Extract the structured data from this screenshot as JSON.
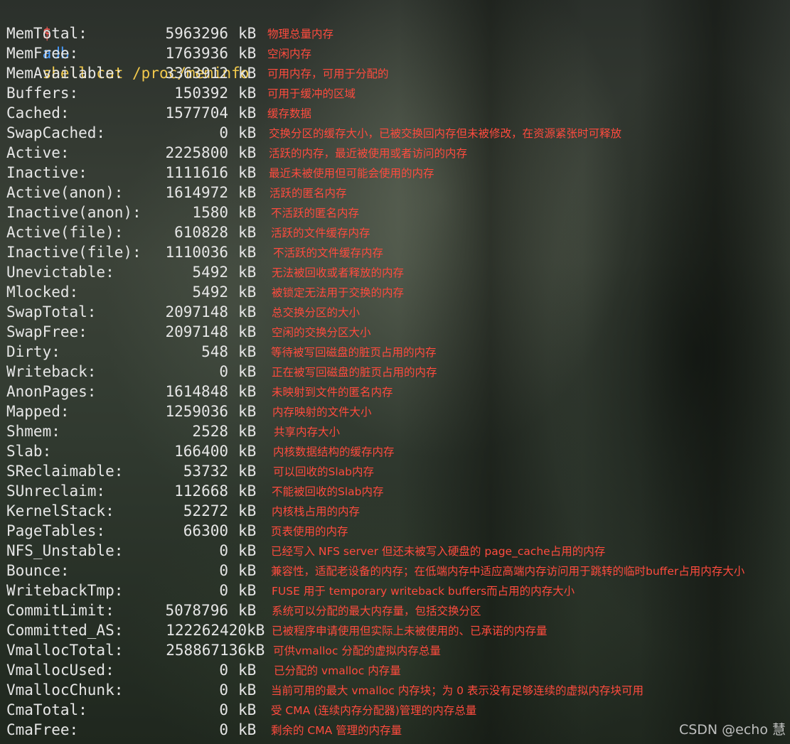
{
  "terminal": {
    "prompt": "$",
    "command": "adb",
    "arguments": "shell cat /proc/meminfo",
    "unit": "kB",
    "rows": [
      {
        "key": "MemTotal:",
        "value": "5963296",
        "note": "物理总量内存"
      },
      {
        "key": "MemFree:",
        "value": "1763936",
        "note": "空闲内存"
      },
      {
        "key": "MemAvailable:",
        "value": "3363912",
        "note": "可用内存，可用于分配的"
      },
      {
        "key": "Buffers:",
        "value": "150392",
        "note": "可用于缓冲的区域"
      },
      {
        "key": "Cached:",
        "value": "1577704",
        "note": "缓存数据"
      },
      {
        "key": "SwapCached:",
        "value": "0",
        "note": "交换分区的缓存大小，已被交换回内存但未被修改，在资源紧张时可释放"
      },
      {
        "key": "Active:",
        "value": "2225800",
        "note": "活跃的内存，最近被使用或者访问的内存"
      },
      {
        "key": "Inactive:",
        "value": "1111616",
        "note": "最近未被使用但可能会使用的内存"
      },
      {
        "key": "Active(anon):",
        "value": "1614972",
        "note": "活跃的匿名内存"
      },
      {
        "key": "Inactive(anon):",
        "value": "1580",
        "note": "不活跃的匿名内存"
      },
      {
        "key": "Active(file):",
        "value": "610828",
        "note": "活跃的文件缓存内存"
      },
      {
        "key": "Inactive(file):",
        "value": "1110036",
        "note": "不活跃的文件缓存内存"
      },
      {
        "key": "Unevictable:",
        "value": "5492",
        "note": "无法被回收或者释放的内存"
      },
      {
        "key": "Mlocked:",
        "value": "5492",
        "note": "被锁定无法用于交换的内存"
      },
      {
        "key": "SwapTotal:",
        "value": "2097148",
        "note": "总交换分区的大小"
      },
      {
        "key": "SwapFree:",
        "value": "2097148",
        "note": "空闲的交换分区大小"
      },
      {
        "key": "Dirty:",
        "value": "548",
        "note": "等待被写回磁盘的脏页占用的内存"
      },
      {
        "key": "Writeback:",
        "value": "0",
        "note": "正在被写回磁盘的脏页占用的内存"
      },
      {
        "key": "AnonPages:",
        "value": "1614848",
        "note": "未映射到文件的匿名内存"
      },
      {
        "key": "Mapped:",
        "value": "1259036",
        "note": "内存映射的文件大小"
      },
      {
        "key": "Shmem:",
        "value": "2528",
        "note": "共享内存大小"
      },
      {
        "key": "Slab:",
        "value": "166400",
        "note": "内核数据结构的缓存内存"
      },
      {
        "key": "SReclaimable:",
        "value": "53732",
        "note": "可以回收的Slab内存"
      },
      {
        "key": "SUnreclaim:",
        "value": "112668",
        "note": "不能被回收的Slab内存"
      },
      {
        "key": "KernelStack:",
        "value": "52272",
        "note": "内核栈占用的内存"
      },
      {
        "key": "PageTables:",
        "value": "66300",
        "note": "页表使用的内存"
      },
      {
        "key": "NFS_Unstable:",
        "value": "0",
        "note": "已经写入 NFS server 但还未被写入硬盘的 page_cache占用的内存"
      },
      {
        "key": "Bounce:",
        "value": "0",
        "note": "兼容性，适配老设备的内存；在低端内存中适应高端内存访问用于跳转的临时buffer占用内存大小"
      },
      {
        "key": "WritebackTmp:",
        "value": "0",
        "note": "FUSE 用于 temporary writeback buffers而占用的内存大小"
      },
      {
        "key": "CommitLimit:",
        "value": "5078796",
        "note": "系统可以分配的最大内存量，包括交换分区"
      },
      {
        "key": "Committed_AS:",
        "value": "122262420",
        "note": "已被程序申请使用但实际上未被使用的、已承诺的内存量"
      },
      {
        "key": "VmallocTotal:",
        "value": "258867136",
        "note": "可供vmalloc 分配的虚拟内存总量"
      },
      {
        "key": "VmallocUsed:",
        "value": "0",
        "note": "已分配的 vmalloc 内存量"
      },
      {
        "key": "VmallocChunk:",
        "value": "0",
        "note": "当前可用的最大 vmalloc 内存块；为 0 表示没有足够连续的虚拟内存块可用"
      },
      {
        "key": "CmaTotal:",
        "value": "0",
        "note": "受 CMA (连续内存分配器)管理的内存总量"
      },
      {
        "key": "CmaFree:",
        "value": "0",
        "note": "剩余的 CMA 管理的内存量"
      }
    ]
  },
  "watermark": "CSDN @echo 慧",
  "colors": {
    "prompt": "#ff5c57",
    "command": "#4a9dff",
    "arguments": "#f2c94c",
    "output": "#e6e6e6",
    "annotation": "#ff4b3e"
  }
}
